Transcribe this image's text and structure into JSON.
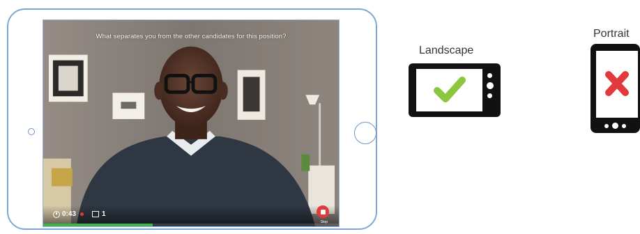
{
  "video": {
    "question": "What separates you from the other candidates for this position?",
    "timer": "0:43",
    "question_count": "1",
    "stop_label": "Stop",
    "progress_fraction": 0.37,
    "recording_color": "#e23b2f",
    "progress_color": "#3fb24a",
    "stop_color": "#e6393a"
  },
  "orientation": {
    "landscape": {
      "label": "Landscape",
      "status": "check-icon",
      "status_color": "#8cc63f"
    },
    "portrait": {
      "label": "Portrait",
      "status": "cross-icon",
      "status_color": "#e03a3e"
    }
  },
  "frame_color": "#7ea6d6"
}
